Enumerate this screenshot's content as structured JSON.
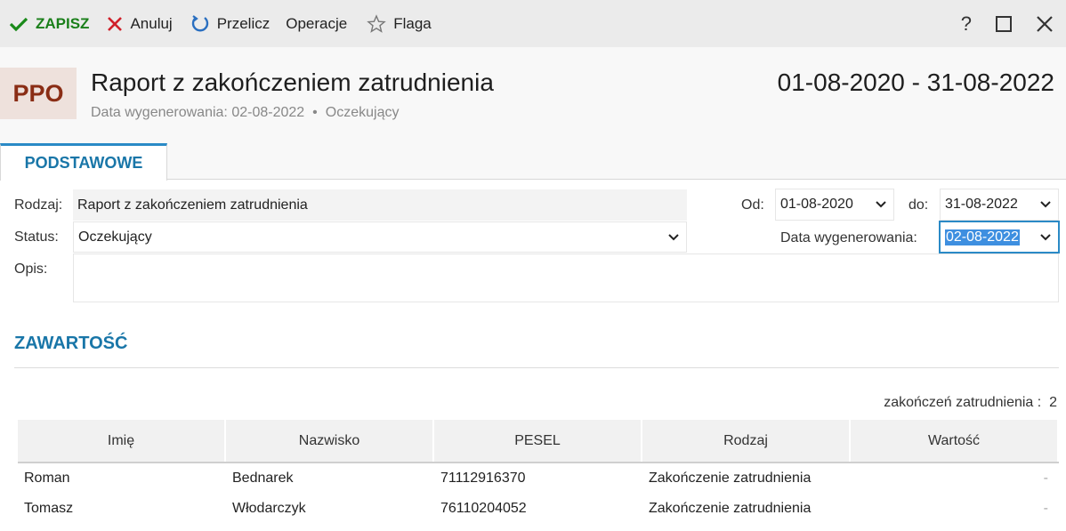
{
  "toolbar": {
    "save": "ZAPISZ",
    "cancel": "Anuluj",
    "recalc": "Przelicz",
    "operations": "Operacje",
    "flag": "Flaga",
    "help": "?"
  },
  "header": {
    "badge": "PPO",
    "title": "Raport z zakończeniem zatrudnienia",
    "generated_label": "Data wygenerowania: 02-08-2022",
    "status": "Oczekujący",
    "range": "01-08-2020 - 31-08-2022"
  },
  "tabs": [
    {
      "label": "PODSTAWOWE"
    }
  ],
  "form": {
    "type_label": "Rodzaj:",
    "type_value": "Raport z zakończeniem zatrudnienia",
    "status_label": "Status:",
    "status_value": "Oczekujący",
    "desc_label": "Opis:",
    "from_label": "Od:",
    "from_value": "01-08-2020",
    "to_label": "do:",
    "to_value": "31-08-2022",
    "gen_label": "Data wygenerowania:",
    "gen_value": "02-08-2022"
  },
  "content": {
    "title": "ZAWARTOŚĆ",
    "count_label": "zakończeń zatrudnienia :",
    "count_value": "2",
    "columns": [
      "Imię",
      "Nazwisko",
      "PESEL",
      "Rodzaj",
      "Wartość"
    ],
    "rows": [
      [
        "Roman",
        "Bednarek",
        "71112916370",
        "Zakończenie zatrudnienia",
        "-"
      ],
      [
        "Tomasz",
        "Włodarczyk",
        "76110204052",
        "Zakończenie zatrudnienia",
        "-"
      ]
    ]
  },
  "colors": {
    "accent": "#1976a8",
    "save": "#1a7f1a",
    "cancel": "#d0202a",
    "badge_bg": "#eee1dc",
    "badge_fg": "#8a2d15"
  }
}
